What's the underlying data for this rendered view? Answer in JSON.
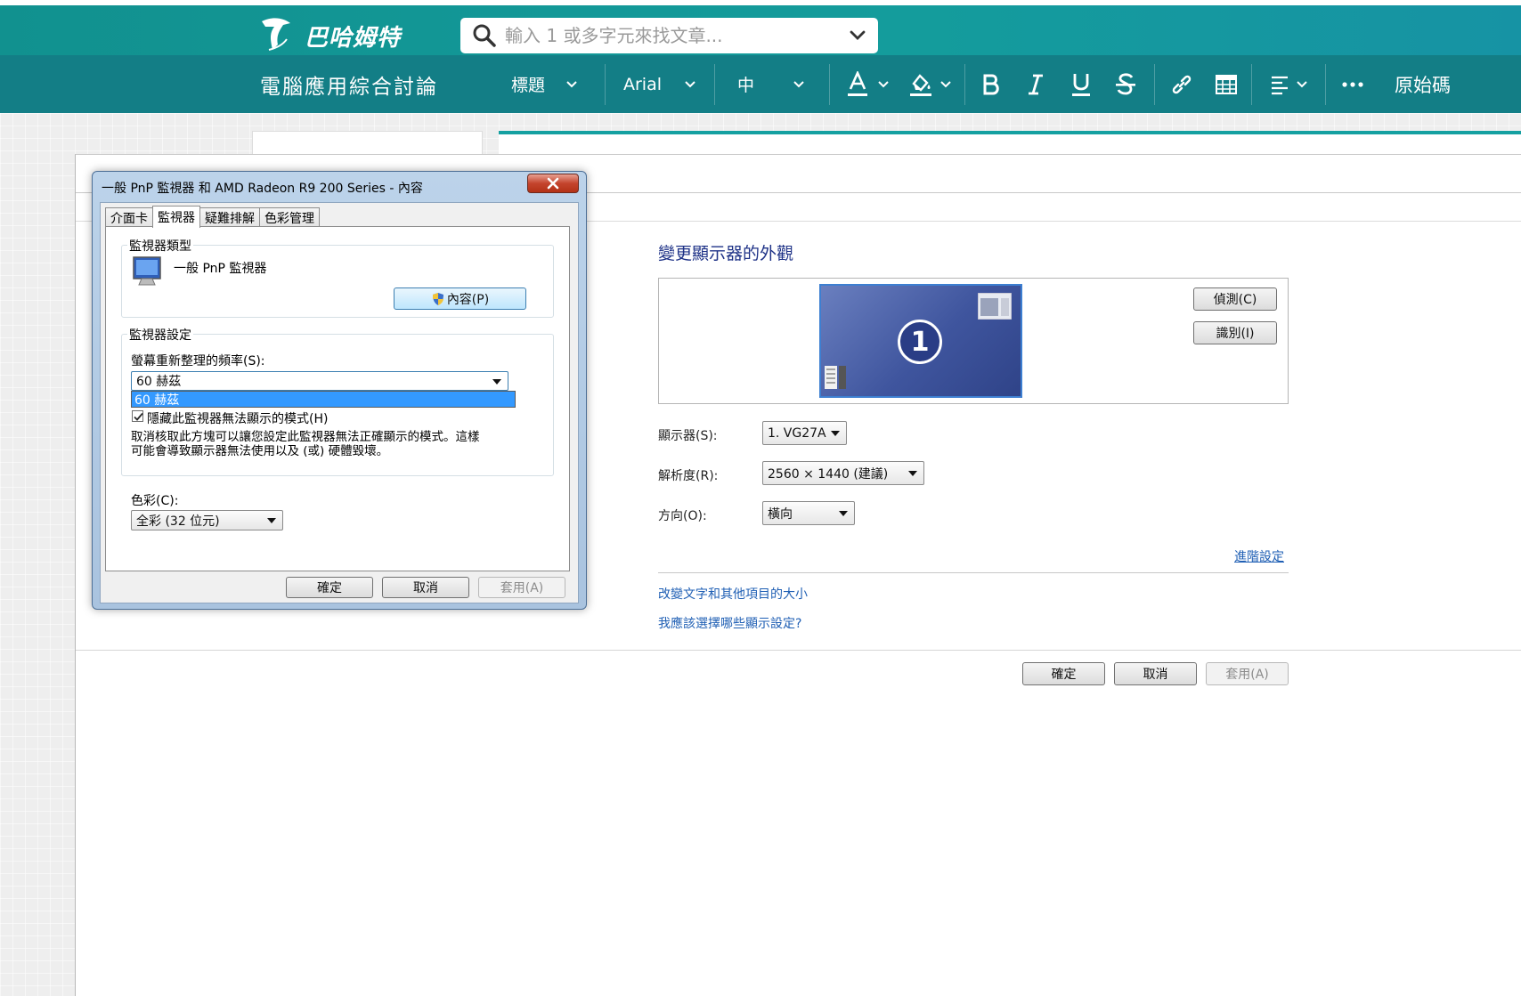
{
  "site": {
    "logo_text": "巴哈姆特",
    "search_placeholder": "輸入 1 或多字元來找文章..."
  },
  "toolbar": {
    "forum_title": "電腦應用綜合討論",
    "heading_select": "標題",
    "font_select": "Arial",
    "size_select": "中",
    "source_label": "原始碼",
    "icons": [
      "font-color-icon",
      "highlight-icon",
      "bold-icon",
      "italic-icon",
      "underline-icon",
      "strikethrough-icon",
      "link-icon",
      "table-icon",
      "align-icon",
      "more-icon"
    ]
  },
  "display_settings": {
    "heading": "變更顯示器的外觀",
    "monitor_number": "1",
    "detect_button": "偵測(C)",
    "identify_button": "識別(I)",
    "display_label": "顯示器(S):",
    "display_value": "1. VG27A",
    "resolution_label": "解析度(R):",
    "resolution_value": "2560 × 1440 (建議)",
    "orientation_label": "方向(O):",
    "orientation_value": "橫向",
    "advanced_link": "進階設定",
    "text_size_link": "改變文字和其他項目的大小",
    "which_settings_link": "我應該選擇哪些顯示設定?",
    "ok_button": "確定",
    "cancel_button": "取消",
    "apply_button": "套用(A)"
  },
  "dialog": {
    "title": "一般 PnP 監視器 和 AMD Radeon R9 200 Series - 內容",
    "tabs": [
      "介面卡",
      "監視器",
      "疑難排解",
      "色彩管理"
    ],
    "active_tab": "監視器",
    "monitor_type_group": "監視器類型",
    "monitor_name": "一般 PnP 監視器",
    "properties_button": "內容(P)",
    "monitor_settings_group": "監視器設定",
    "refresh_label": "螢幕重新整理的頻率(S):",
    "refresh_value": "60 赫茲",
    "refresh_option_highlighted": "60 赫茲",
    "hide_modes_label": "隱藏此監視器無法顯示的模式(H)",
    "hide_modes_checked": true,
    "warning_line1": "取消核取此方塊可以讓您設定此監視器無法正確顯示的模式。這樣",
    "warning_line2": "可能會導致顯示器無法使用以及 (或) 硬體毀壞。",
    "colors_label": "色彩(C):",
    "colors_value": "全彩 (32 位元)",
    "ok_button": "確定",
    "cancel_button": "取消",
    "apply_button": "套用(A)"
  }
}
